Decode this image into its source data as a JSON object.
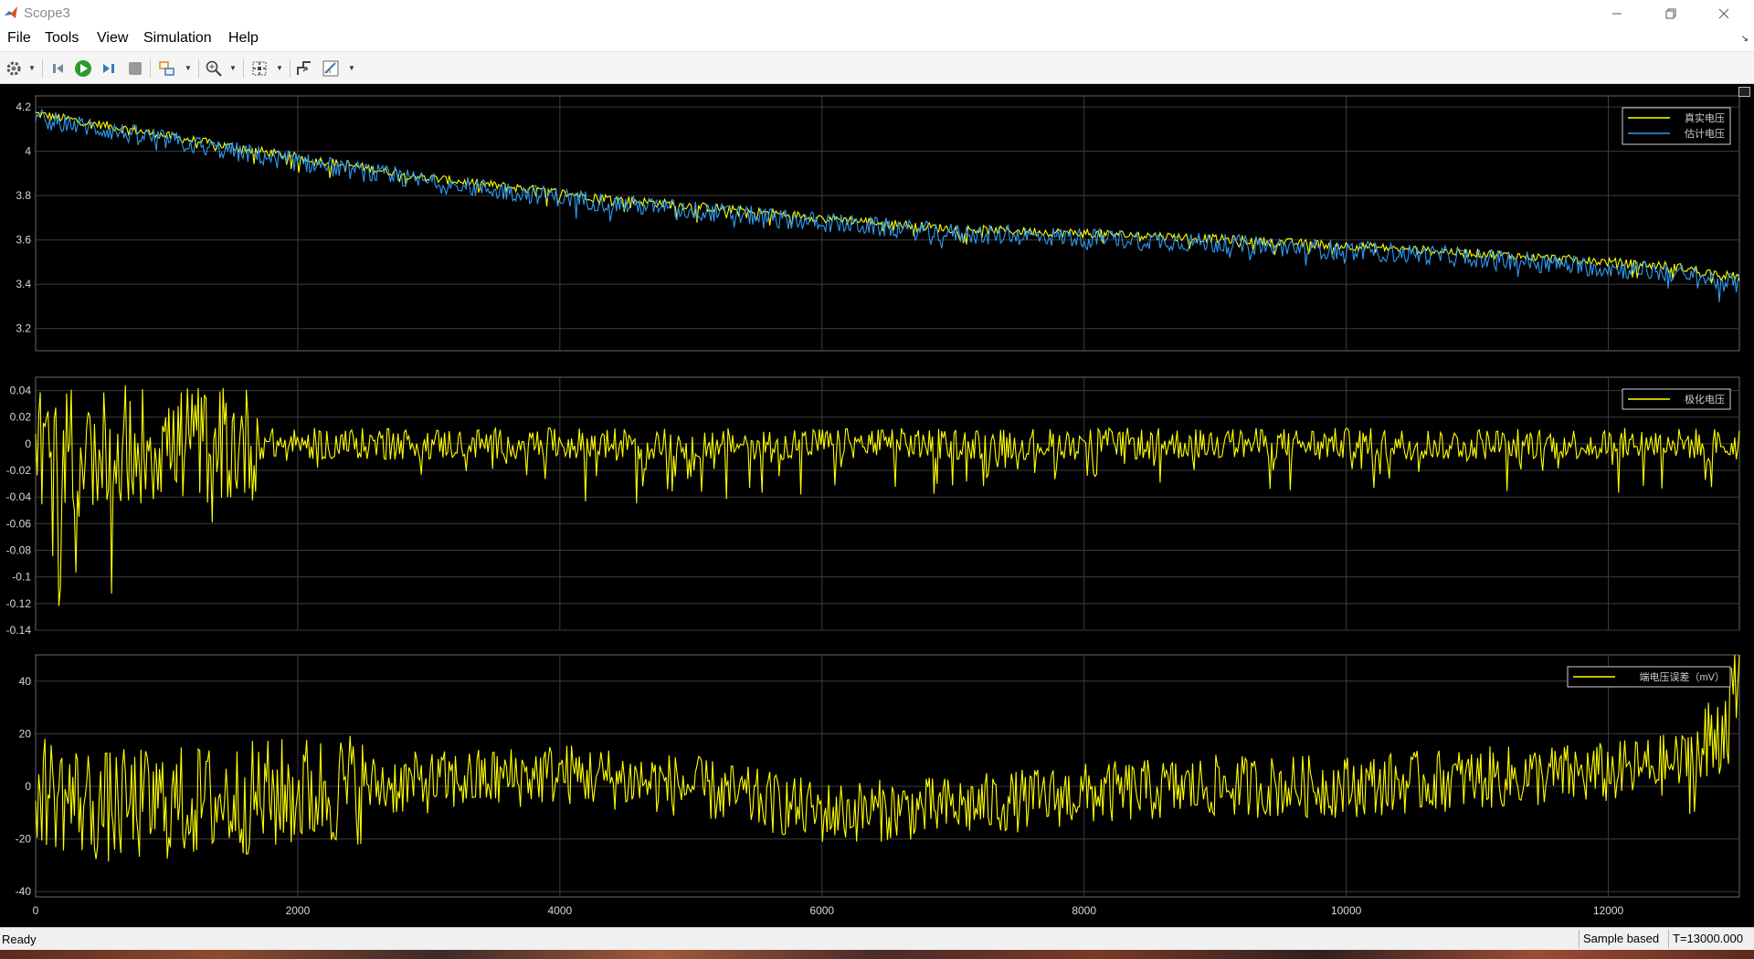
{
  "window": {
    "title": "Scope3",
    "controls": [
      "minimize",
      "restore",
      "close"
    ]
  },
  "menu": [
    "File",
    "Tools",
    "View",
    "Simulation",
    "Help"
  ],
  "toolbar": {
    "buttons": [
      {
        "name": "settings-icon",
        "dropdown": true
      },
      {
        "name": "step-back-icon"
      },
      {
        "name": "run-icon"
      },
      {
        "name": "step-forward-icon"
      },
      {
        "name": "stop-icon"
      },
      {
        "name": "highlight-block-icon",
        "dropdown": true
      },
      {
        "name": "zoom-icon",
        "dropdown": true
      },
      {
        "name": "autoscale-icon",
        "dropdown": true
      },
      {
        "name": "trigger-icon"
      },
      {
        "name": "measurements-icon",
        "dropdown": true
      }
    ]
  },
  "chart_data": [
    {
      "type": "line",
      "xlim": [
        0,
        13000
      ],
      "ylim": [
        3.1,
        4.25
      ],
      "yticks": [
        "4.2",
        "4",
        "3.8",
        "3.6",
        "3.4",
        "3.2"
      ],
      "grid": true,
      "legend_position": "top-right",
      "series": [
        {
          "name": "真实电压",
          "color": "#ffff00",
          "x": [
            0,
            1000,
            1500,
            3000,
            4500,
            6000,
            7000,
            8500,
            9800,
            11000,
            12500,
            13000
          ],
          "values": [
            4.17,
            4.07,
            4.02,
            3.88,
            3.78,
            3.7,
            3.65,
            3.62,
            3.58,
            3.54,
            3.48,
            3.43
          ]
        },
        {
          "name": "估计电压",
          "color": "#2f9bf0",
          "x": [
            0,
            1000,
            1500,
            3000,
            4500,
            6000,
            7000,
            8500,
            9800,
            11000,
            12500,
            13000
          ],
          "values": [
            4.15,
            4.05,
            4.0,
            3.86,
            3.76,
            3.68,
            3.63,
            3.6,
            3.56,
            3.52,
            3.45,
            3.4
          ]
        }
      ]
    },
    {
      "type": "line",
      "xlim": [
        0,
        13000
      ],
      "ylim": [
        -0.14,
        0.05
      ],
      "yticks": [
        "0.04",
        "0.02",
        "0",
        "-0.02",
        "-0.04",
        "-0.06",
        "-0.08",
        "-0.1",
        "-0.12",
        "-0.14"
      ],
      "grid": true,
      "legend_position": "top-right",
      "series": [
        {
          "name": "极化电压",
          "color": "#ffff00",
          "x": [
            0,
            200,
            250,
            400,
            1000,
            1600,
            2500,
            3000,
            4400,
            5800,
            7200,
            8500,
            10000,
            11500,
            12800,
            13000
          ],
          "values": [
            0,
            -0.12,
            0.03,
            -0.1,
            0.02,
            -0.05,
            0.01,
            -0.04,
            -0.035,
            -0.04,
            -0.035,
            -0.03,
            -0.03,
            -0.025,
            -0.04,
            0
          ]
        }
      ]
    },
    {
      "type": "line",
      "xlim": [
        0,
        13000
      ],
      "ylim": [
        -42,
        50
      ],
      "xticks": [
        "0",
        "2000",
        "4000",
        "6000",
        "8000",
        "10000",
        "12000"
      ],
      "yticks": [
        "40",
        "20",
        "0",
        "-20",
        "-40"
      ],
      "grid": true,
      "legend_position": "top-right",
      "series": [
        {
          "name": "端电压误差（mV）",
          "color": "#ffff00",
          "x": [
            0,
            500,
            1500,
            2500,
            3500,
            4000,
            5000,
            6000,
            7000,
            8000,
            9000,
            10000,
            11000,
            12000,
            12700,
            13000
          ],
          "values": [
            0,
            -8,
            -5,
            0,
            3,
            5,
            0,
            -10,
            -8,
            -3,
            0,
            0,
            3,
            5,
            10,
            35
          ]
        }
      ]
    }
  ],
  "status": {
    "left": "Ready",
    "mode": "Sample based",
    "time": "T=13000.000"
  }
}
